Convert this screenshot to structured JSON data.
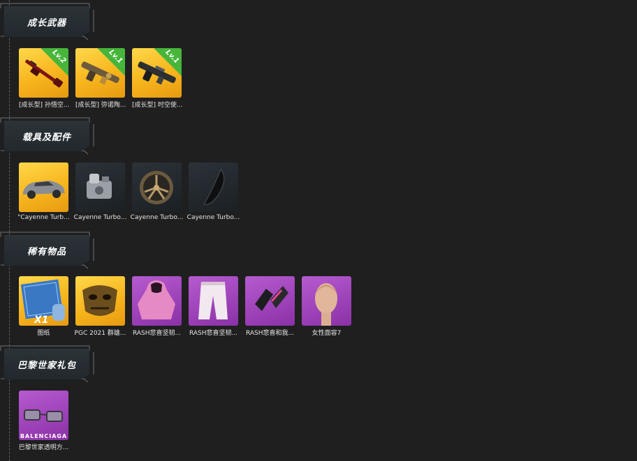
{
  "sections": [
    {
      "title": "成长武器",
      "items": [
        {
          "label": "[成长型] 孙悟空...",
          "level": "Lv.2",
          "icon": "rifle-red-icon"
        },
        {
          "label": "[成长型] 弥诺陶...",
          "level": "Lv.1",
          "icon": "smg-bronze-icon"
        },
        {
          "label": "[成长型] 时空使...",
          "level": "Lv.1",
          "icon": "smg-dark-icon"
        }
      ]
    },
    {
      "title": "载具及配件",
      "items": [
        {
          "label": "\"Cayenne Turb...",
          "icon": "car-icon"
        },
        {
          "label": "Cayenne Turbo...",
          "icon": "engine-icon"
        },
        {
          "label": "Cayenne Turbo...",
          "icon": "wheel-icon"
        },
        {
          "label": "Cayenne Turbo...",
          "icon": "spoiler-icon"
        }
      ]
    },
    {
      "title": "稀有物品",
      "items": [
        {
          "label": "图纸",
          "badge": "X1",
          "icon": "blueprint-icon"
        },
        {
          "label": "PGC 2021 群雄...",
          "icon": "mask-icon"
        },
        {
          "label": "RASH悲喜坚韧...",
          "icon": "hoodie-icon"
        },
        {
          "label": "RASH悲喜坚韧...",
          "icon": "pants-icon"
        },
        {
          "label": "RASH悲喜和我...",
          "icon": "gloves-icon"
        },
        {
          "label": "女性面容7",
          "icon": "face-icon"
        }
      ]
    },
    {
      "title": "巴黎世家礼包",
      "items": [
        {
          "label": "巴黎世家透明方...",
          "brand": "BALENCIAGA",
          "icon": "glasses-icon"
        }
      ]
    }
  ]
}
